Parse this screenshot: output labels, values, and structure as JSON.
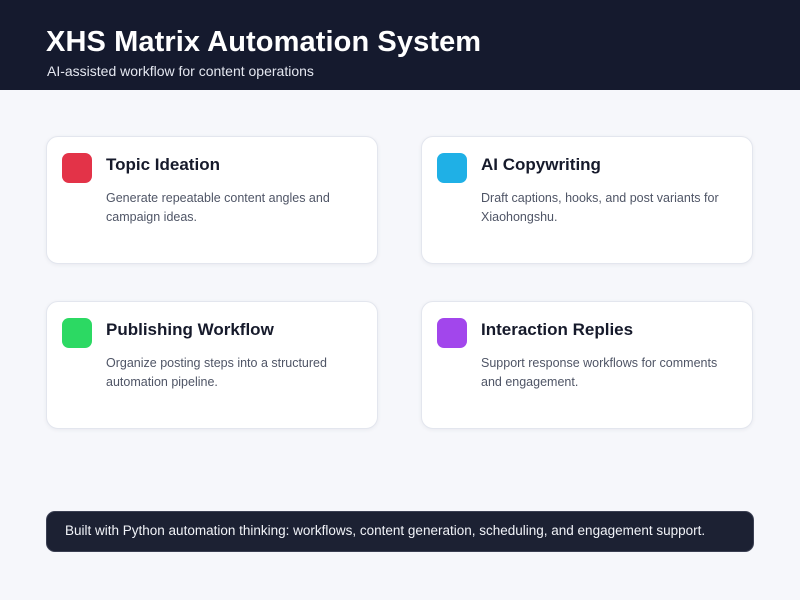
{
  "header": {
    "title": "XHS Matrix Automation System",
    "subtitle": "AI-assisted workflow for content operations"
  },
  "cards": [
    {
      "title": "Topic Ideation",
      "description": "Generate repeatable content angles and campaign ideas.",
      "icon": "red-square-icon",
      "color": "#e33348"
    },
    {
      "title": "AI Copywriting",
      "description": "Draft captions, hooks, and post variants for Xiaohongshu.",
      "icon": "blue-square-icon",
      "color": "#1fb0e6"
    },
    {
      "title": "Publishing Workflow",
      "description": "Organize posting steps into a structured automation pipeline.",
      "icon": "green-square-icon",
      "color": "#2cd963"
    },
    {
      "title": "Interaction Replies",
      "description": "Support response workflows for comments and engagement.",
      "icon": "purple-square-icon",
      "color": "#a246ec"
    }
  ],
  "footer": {
    "text": "Built with Python automation thinking: workflows, content generation, scheduling, and engagement support."
  },
  "colors": {
    "header_bg": "#151a2e",
    "page_bg": "#f6f7fb",
    "footer_bg": "#1c2133"
  }
}
